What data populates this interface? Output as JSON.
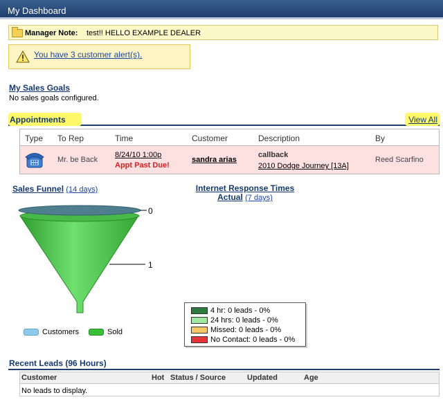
{
  "title": "My Dashboard",
  "manager_note": {
    "label": "Manager Note:",
    "text": "test!! HELLO EXAMPLE DEALER"
  },
  "alert": {
    "text": "You have 3 customer alert(s)."
  },
  "sales_goals": {
    "title": "My Sales Goals",
    "text": "No sales goals configured."
  },
  "appointments": {
    "title": "Appointments",
    "view_all": "View All",
    "columns": [
      "Type",
      "To Rep",
      "Time",
      "Customer",
      "Description",
      "By"
    ],
    "row": {
      "to_rep": "Mr. be Back",
      "time": "8/24/10 1:00p",
      "status": "Appt Past Due!",
      "customer": "sandra arias",
      "description": "callback",
      "vehicle": "2010 Dodge Journey [13A]",
      "by": "Reed Scarfino"
    }
  },
  "sales_funnel": {
    "title": "Sales Funnel",
    "period": "(14 days)",
    "labels": {
      "top": "0",
      "mid": "1"
    },
    "legend": [
      {
        "label": "Customers",
        "color": "#8ecbea"
      },
      {
        "label": "Sold",
        "color": "#38c038"
      }
    ]
  },
  "internet_response": {
    "title_line1": "Internet Response Times",
    "title_line2": "Actual",
    "period": "(7 days)",
    "legend": [
      {
        "label": "4 hr: 0 leads - 0%",
        "color": "#2f7a3e"
      },
      {
        "label": "24 hrs: 0 leads - 0%",
        "color": "#9ee8a0"
      },
      {
        "label": "Missed: 0 leads - 0%",
        "color": "#f6c866"
      },
      {
        "label": "No Contact: 0 leads - 0%",
        "color": "#e8333a"
      }
    ]
  },
  "recent_leads": {
    "title": "Recent Leads (96 Hours)",
    "columns": [
      "Customer",
      "Hot",
      "Status / Source",
      "Updated",
      "Age"
    ],
    "empty_text": "No leads to display."
  }
}
